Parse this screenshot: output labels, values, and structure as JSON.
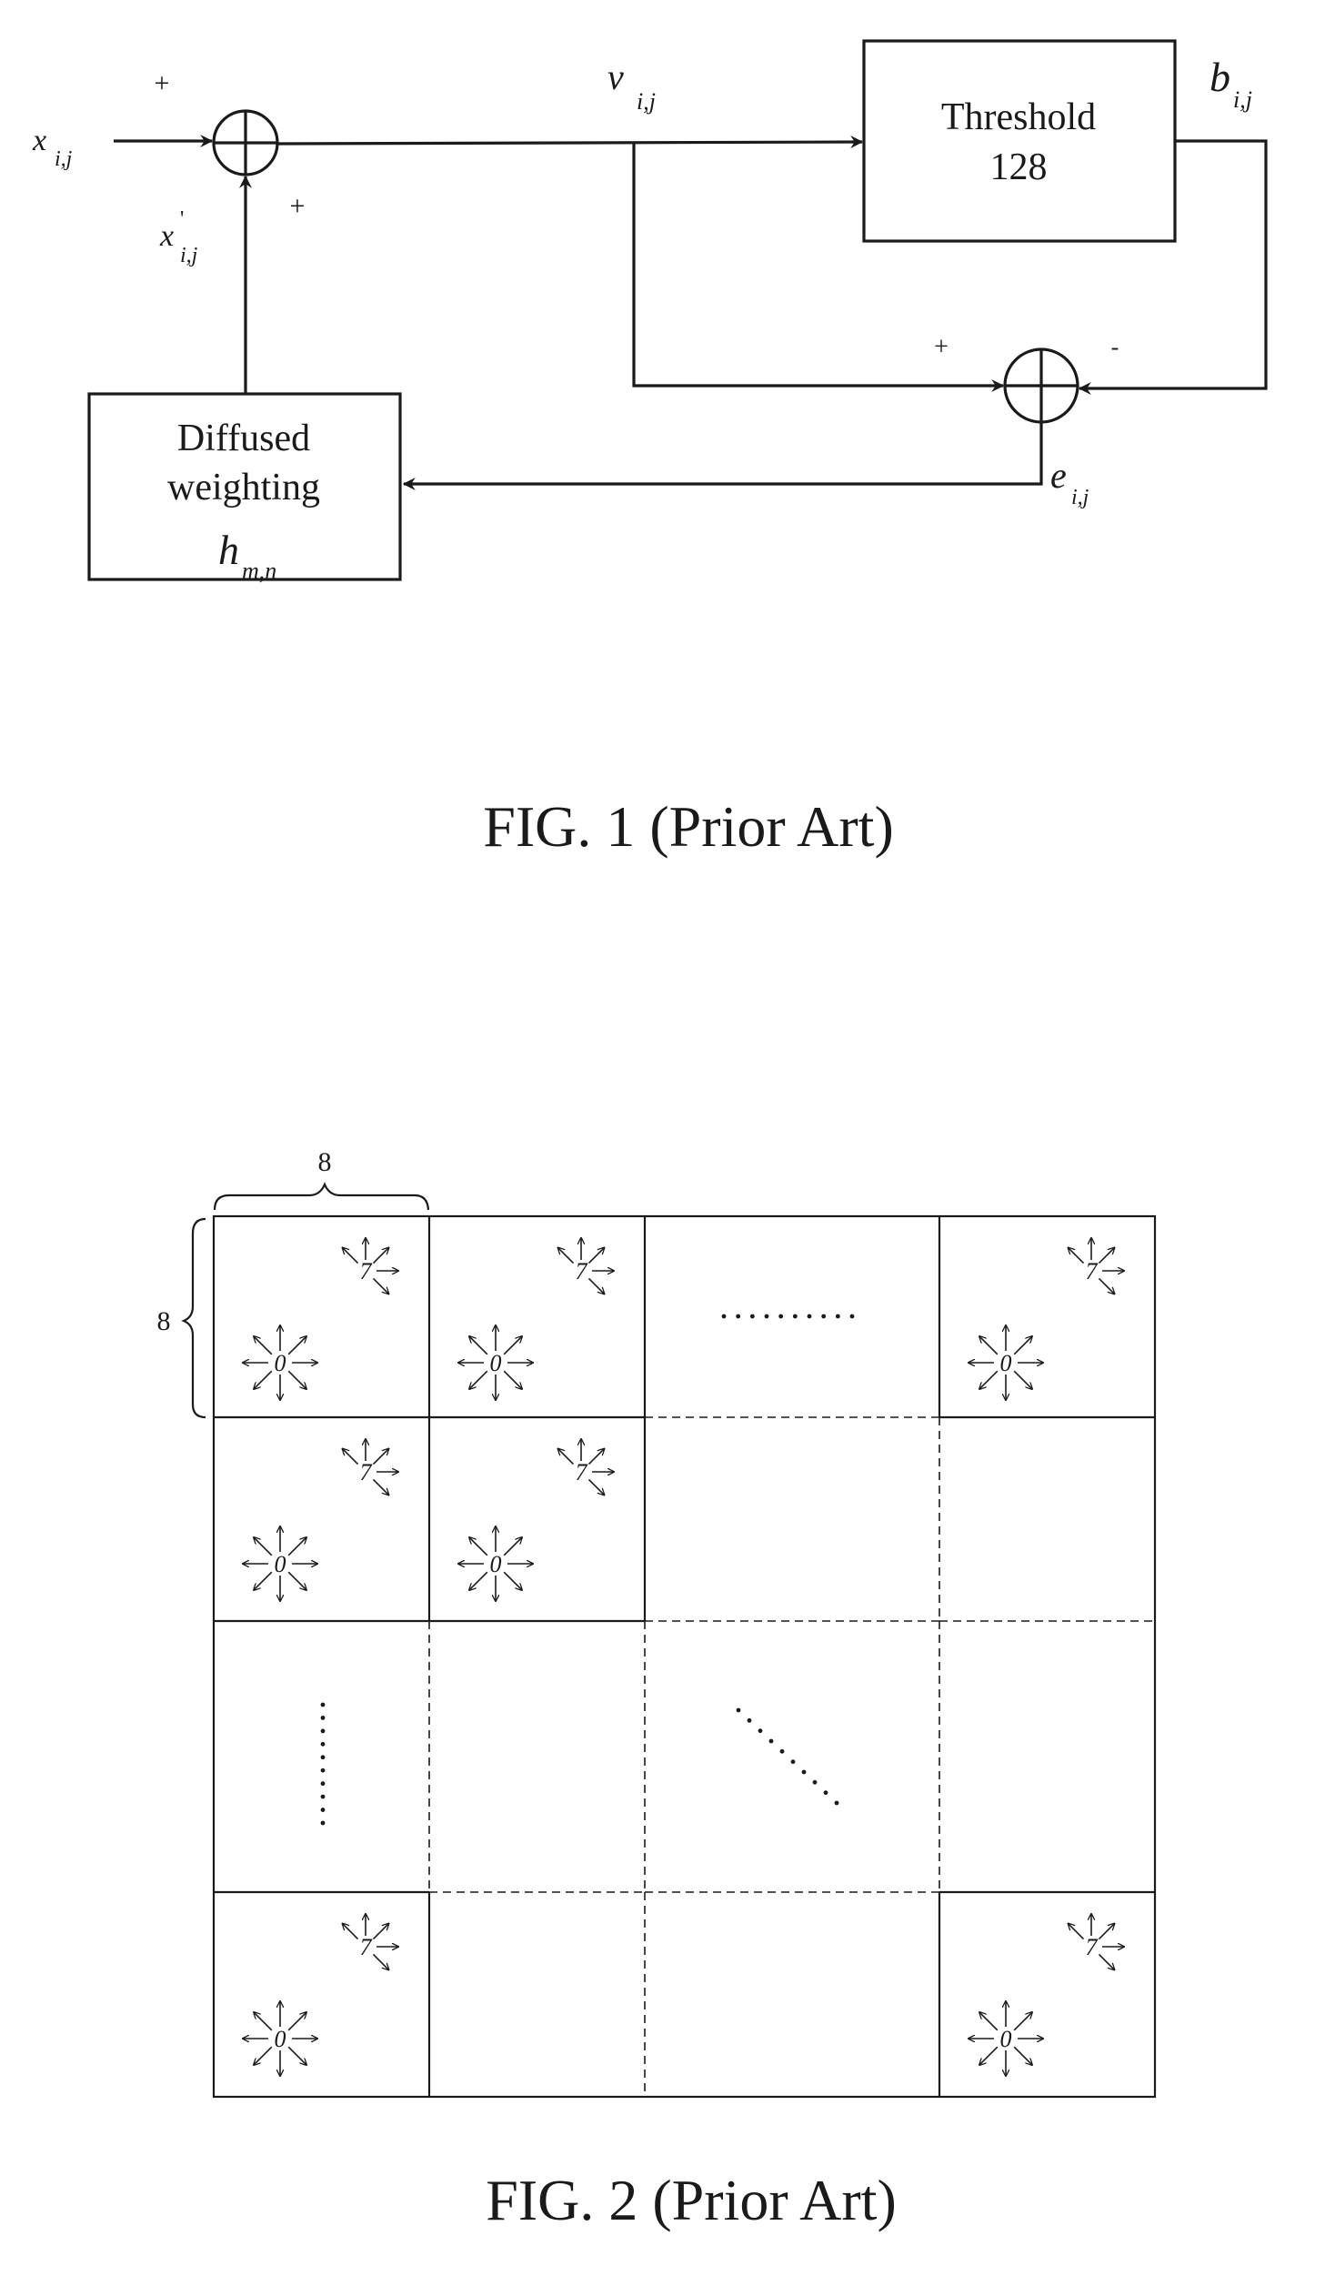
{
  "fig1": {
    "caption": "FIG. 1 (Prior Art)",
    "blocks": {
      "threshold": {
        "line1": "Threshold",
        "line2": "128"
      },
      "diffused": {
        "line1": "Diffused",
        "line2": "weighting",
        "symbol": "h",
        "symbol_sub": "m,n"
      }
    },
    "signals": {
      "input": {
        "symbol": "x",
        "sub": "i,j"
      },
      "feedback": {
        "symbol": "x",
        "prime": "'",
        "sub": "i,j"
      },
      "sum": {
        "symbol": "v",
        "sub": "i,j"
      },
      "output": {
        "symbol": "b",
        "sub": "i,j"
      },
      "error": {
        "symbol": "e",
        "sub": "i,j"
      }
    },
    "signs": {
      "adder1_input": "+",
      "adder1_feedback": "+",
      "adder2_positive": "+",
      "adder2_negative": "-"
    }
  },
  "fig2": {
    "caption": "FIG. 2 (Prior Art)",
    "block_width_label": "8",
    "block_height_label": "8",
    "start_pixel_label": "0",
    "end_pixel_label": "7",
    "grid_rows": 4,
    "grid_cols": 4,
    "blocks_with_diffusion": [
      {
        "row": 0,
        "col": 0
      },
      {
        "row": 0,
        "col": 1
      },
      {
        "row": 0,
        "col": 3
      },
      {
        "row": 1,
        "col": 0
      },
      {
        "row": 1,
        "col": 1
      },
      {
        "row": 3,
        "col": 0
      },
      {
        "row": 3,
        "col": 3
      }
    ],
    "ellipsis_marks": [
      {
        "row": 0,
        "col": 2,
        "direction": "horizontal"
      },
      {
        "row": 2,
        "col": 0,
        "direction": "vertical"
      },
      {
        "row": 2,
        "col": 2,
        "direction": "diagonal"
      }
    ]
  }
}
